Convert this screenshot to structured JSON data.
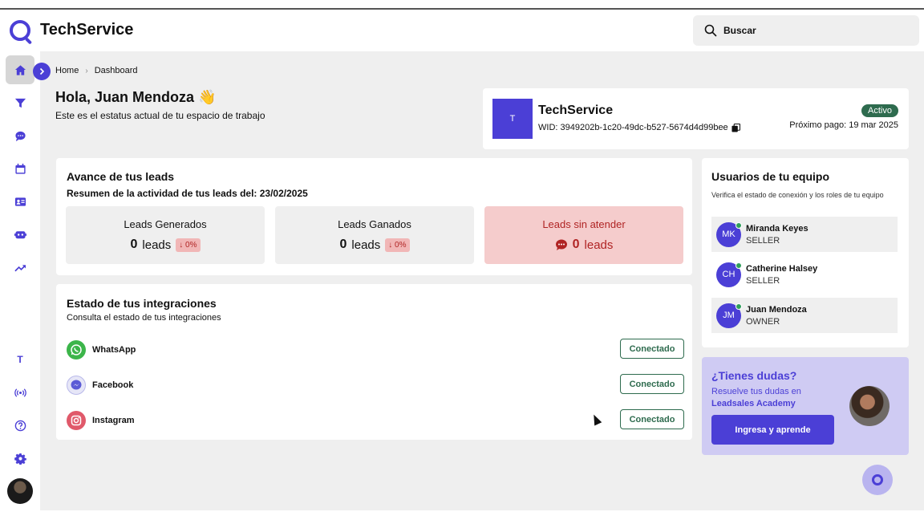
{
  "app": {
    "brand": "TechService"
  },
  "search": {
    "placeholder": "Buscar"
  },
  "sidebar": {
    "items": [
      {
        "name": "home-icon"
      },
      {
        "name": "filter-icon"
      },
      {
        "name": "chat-icon"
      },
      {
        "name": "calendar-icon"
      },
      {
        "name": "contact-card-icon"
      },
      {
        "name": "bot-icon"
      },
      {
        "name": "trending-up-icon"
      }
    ],
    "workspace_letter": "T"
  },
  "breadcrumb": {
    "home": "Home",
    "current": "Dashboard"
  },
  "greeting": {
    "title": "Hola, Juan Mendoza 👋",
    "subtitle": "Este es el estatus actual de tu espacio de trabajo"
  },
  "workspace": {
    "avatar": "T",
    "name": "TechService",
    "wid": "WID: 3949202b-1c20-49dc-b527-5674d4d99bee",
    "status": "Activo",
    "next_payment": "Próximo pago: 19 mar 2025"
  },
  "leads": {
    "title": "Avance de tus leads",
    "summary": "Resumen de la actividad de tus leads del: 23/02/2025",
    "stats": [
      {
        "label": "Leads Generados",
        "value": "0",
        "unit": "leads",
        "delta": "↓ 0%"
      },
      {
        "label": "Leads Ganados",
        "value": "0",
        "unit": "leads",
        "delta": "↓ 0%"
      },
      {
        "label": "Leads sin atender",
        "value": "0",
        "unit": "leads"
      }
    ]
  },
  "integrations": {
    "title": "Estado de tus integraciones",
    "subtitle": "Consulta el estado de tus integraciones",
    "items": [
      {
        "name": "WhatsApp",
        "status": "Conectado",
        "color": "#3cb54a"
      },
      {
        "name": "Facebook",
        "status": "Conectado",
        "color": "#5b5bd6"
      },
      {
        "name": "Instagram",
        "status": "Conectado",
        "color": "#e0596a"
      }
    ]
  },
  "team": {
    "title": "Usuarios de tu equipo",
    "subtitle": "Verifica el estado de conexión y los roles de tu equipo",
    "members": [
      {
        "initials": "MK",
        "name": "Miranda Keyes",
        "role": "SELLER"
      },
      {
        "initials": "CH",
        "name": "Catherine Halsey",
        "role": "SELLER"
      },
      {
        "initials": "JM",
        "name": "Juan Mendoza",
        "role": "OWNER"
      }
    ]
  },
  "promo": {
    "title": "¿Tienes dudas?",
    "line1": "Resuelve tus dudas en",
    "line2": "Leadsales Academy",
    "button": "Ingresa y aprende"
  },
  "colors": {
    "accent": "#4b3fd6",
    "success": "#2e6b4e",
    "danger": "#b02424"
  }
}
